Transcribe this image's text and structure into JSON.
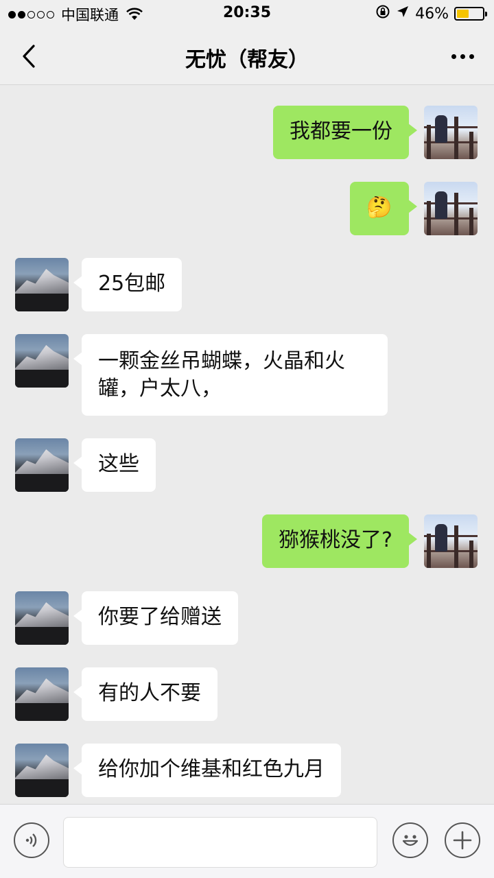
{
  "status_bar": {
    "carrier": "中国联通",
    "time": "20:35",
    "battery_percent": "46%",
    "battery_level": 0.46,
    "signal_bars_filled": 2,
    "signal_bars_total": 5
  },
  "nav": {
    "title": "无忧（帮友）",
    "back_icon": "chevron-left-icon",
    "more_icon": "more-icon"
  },
  "messages": [
    {
      "side": "mine",
      "text": "我都要一份"
    },
    {
      "side": "mine",
      "text": "🤔"
    },
    {
      "side": "theirs",
      "text": "25包邮"
    },
    {
      "side": "theirs",
      "text": "一颗金丝吊蝴蝶，火晶和火罐，户太八，"
    },
    {
      "side": "theirs",
      "text": "这些"
    },
    {
      "side": "mine",
      "text": "猕猴桃没了?"
    },
    {
      "side": "theirs",
      "text": "你要了给赠送"
    },
    {
      "side": "theirs",
      "text": "有的人不要"
    },
    {
      "side": "theirs",
      "text": "给你加个维基和红色九月"
    }
  ],
  "input_bar": {
    "voice_icon": "voice-icon",
    "emoji_icon": "emoji-icon",
    "plus_icon": "plus-icon",
    "input_value": ""
  },
  "colors": {
    "my_bubble": "#9ee761",
    "their_bubble": "#ffffff",
    "background": "#ebebeb",
    "battery": "#f5c400"
  }
}
